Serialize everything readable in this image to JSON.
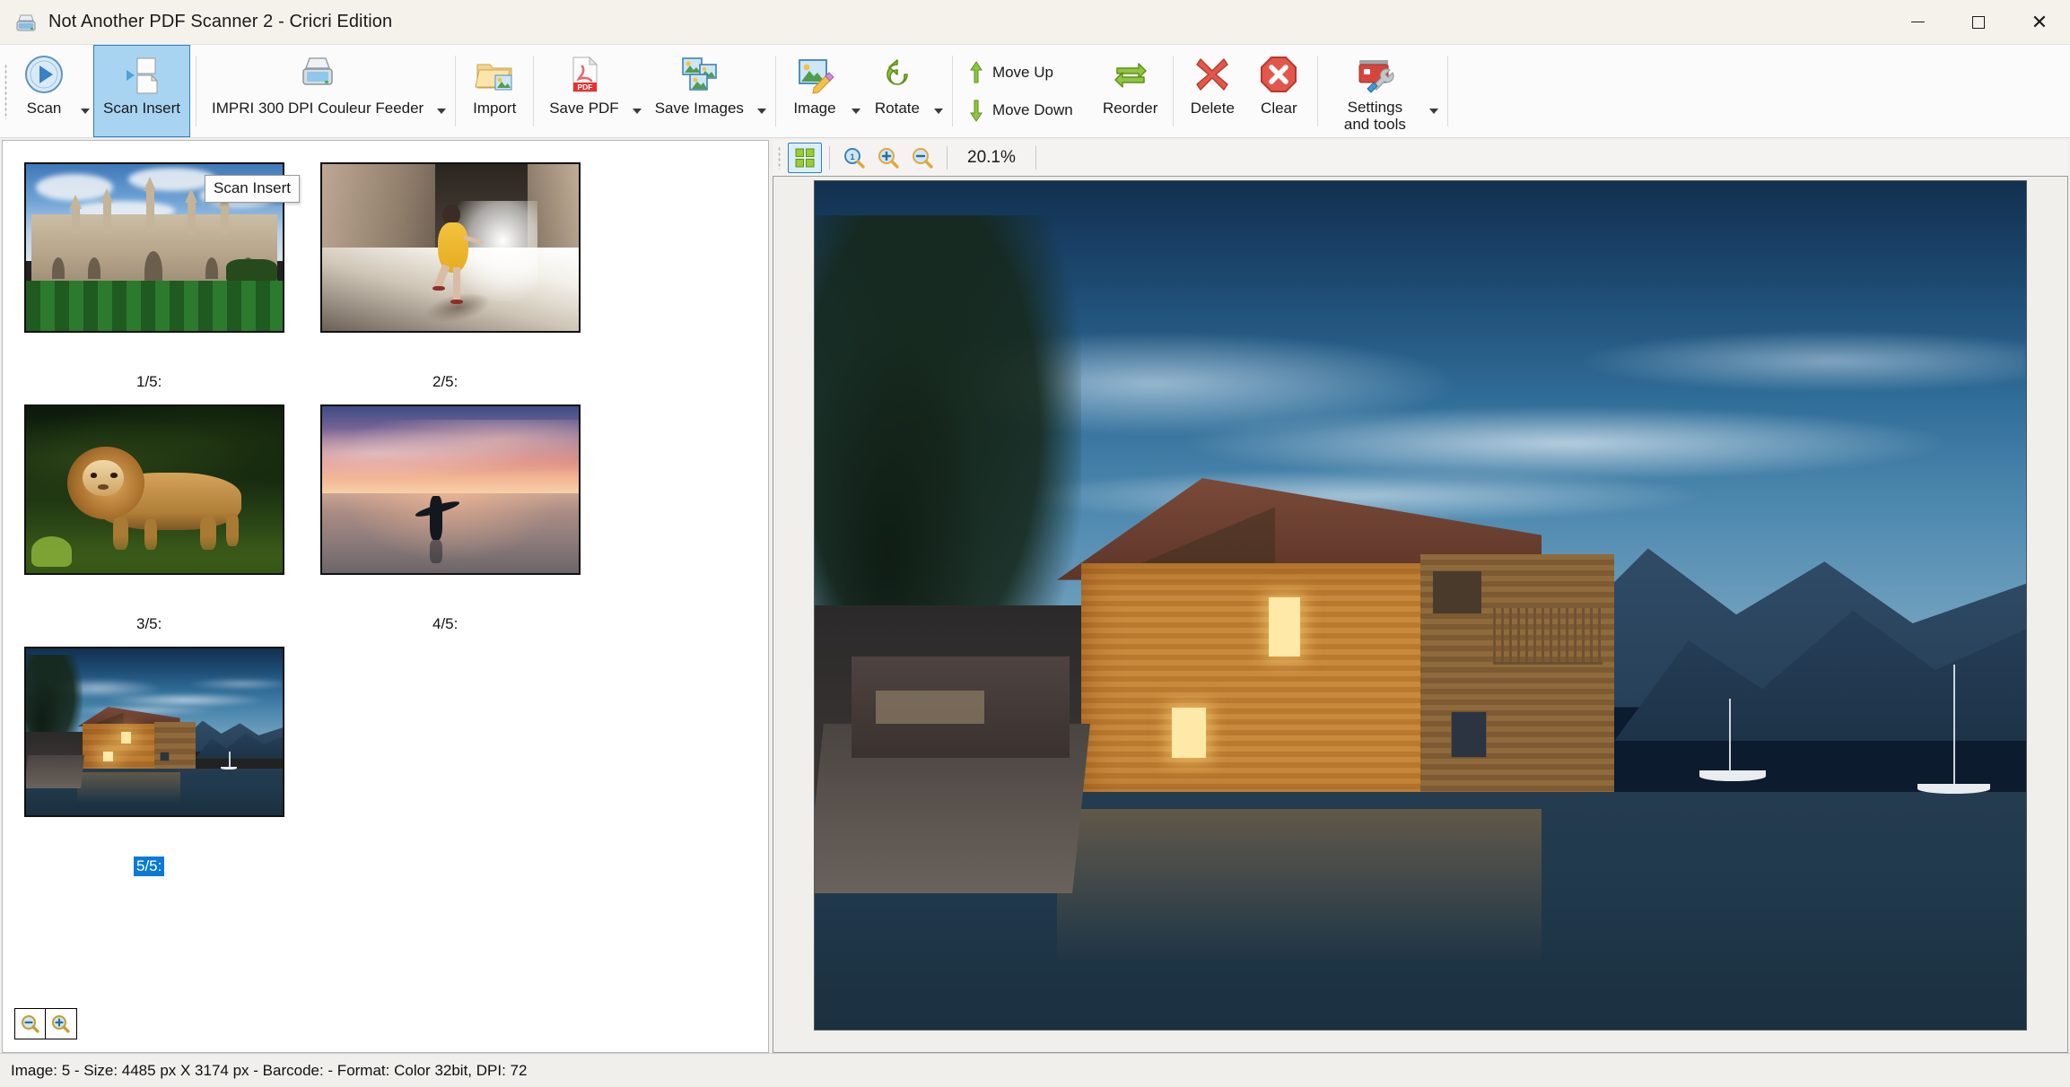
{
  "window": {
    "title": "Not Another PDF Scanner 2 - Cricri Edition",
    "icon": "scanner-icon",
    "controls": {
      "minimize": "Minimize",
      "maximize": "Maximize",
      "close": "Close"
    }
  },
  "ribbon": {
    "items": [
      {
        "id": "scan",
        "label": "Scan",
        "icon": "play-circle-icon",
        "has_dropdown": true,
        "active": false
      },
      {
        "id": "scan-insert",
        "label": "Scan Insert",
        "icon": "insert-page-icon",
        "has_dropdown": false,
        "active": true
      },
      {
        "id": "scanner-select",
        "label": "IMPRI 300 DPI Couleur Feeder",
        "icon": "scanner-icon",
        "has_dropdown": true,
        "active": false
      },
      {
        "id": "import",
        "label": "Import",
        "icon": "folder-image-icon",
        "has_dropdown": false,
        "active": false
      },
      {
        "id": "save-pdf",
        "label": "Save PDF",
        "icon": "pdf-file-icon",
        "has_dropdown": true,
        "active": false
      },
      {
        "id": "save-images",
        "label": "Save Images",
        "icon": "images-stack-icon",
        "has_dropdown": true,
        "active": false
      },
      {
        "id": "image",
        "label": "Image",
        "icon": "image-edit-icon",
        "has_dropdown": true,
        "active": false
      },
      {
        "id": "rotate",
        "label": "Rotate",
        "icon": "rotate-icon",
        "has_dropdown": true,
        "active": false
      },
      {
        "id": "reorder",
        "label": "Reorder",
        "icon": "reorder-arrows-icon",
        "has_dropdown": false,
        "active": false
      },
      {
        "id": "delete",
        "label": "Delete",
        "icon": "red-x-icon",
        "has_dropdown": false,
        "active": false
      },
      {
        "id": "clear",
        "label": "Clear",
        "icon": "stop-octagon-icon",
        "has_dropdown": false,
        "active": false
      },
      {
        "id": "settings-tools",
        "label": "Settings and tools",
        "icon": "toolbox-icon",
        "has_dropdown": true,
        "active": false
      }
    ],
    "move_up": {
      "label": "Move Up",
      "icon": "arrow-up-icon"
    },
    "move_down": {
      "label": "Move Down",
      "icon": "arrow-down-icon"
    },
    "tooltip": "Scan Insert"
  },
  "thumbnails": {
    "pages": [
      {
        "caption": "1/5:",
        "selected": false,
        "art": "college",
        "alt": "College building with lawn"
      },
      {
        "caption": "2/5:",
        "selected": false,
        "art": "corridor",
        "alt": "Girl in yellow dress in corridor"
      },
      {
        "caption": "3/5:",
        "selected": false,
        "art": "lion",
        "alt": "Lion in grass"
      },
      {
        "caption": "4/5:",
        "selected": false,
        "art": "surfer",
        "alt": "Surfer at sunset beach"
      },
      {
        "caption": "5/5:",
        "selected": true,
        "art": "lakehouse",
        "alt": "Wooden lake house at dusk"
      }
    ],
    "zoom_out_label": "Zoom out thumbnails",
    "zoom_in_label": "Zoom in thumbnails"
  },
  "preview": {
    "toolbar": {
      "fit_label": "Fit to window",
      "actual_size_label": "Actual size",
      "zoom_in_label": "Zoom in",
      "zoom_out_label": "Zoom out",
      "zoom_value": "20.1%"
    },
    "image_alt": "Wooden lake house at dusk with mountains and sailboats"
  },
  "status": {
    "text": "Image: 5 - Size: 4485 px X 3174 px  - Barcode:  - Format: Color 32bit, DPI: 72"
  },
  "colors": {
    "accent": "#2a7fc9",
    "selection": "#0a7ad6",
    "active_tab_bg": "#a8d4f2",
    "titlebar_bg": "#f5f2ec",
    "ribbon_bg": "#fbfbfb"
  }
}
